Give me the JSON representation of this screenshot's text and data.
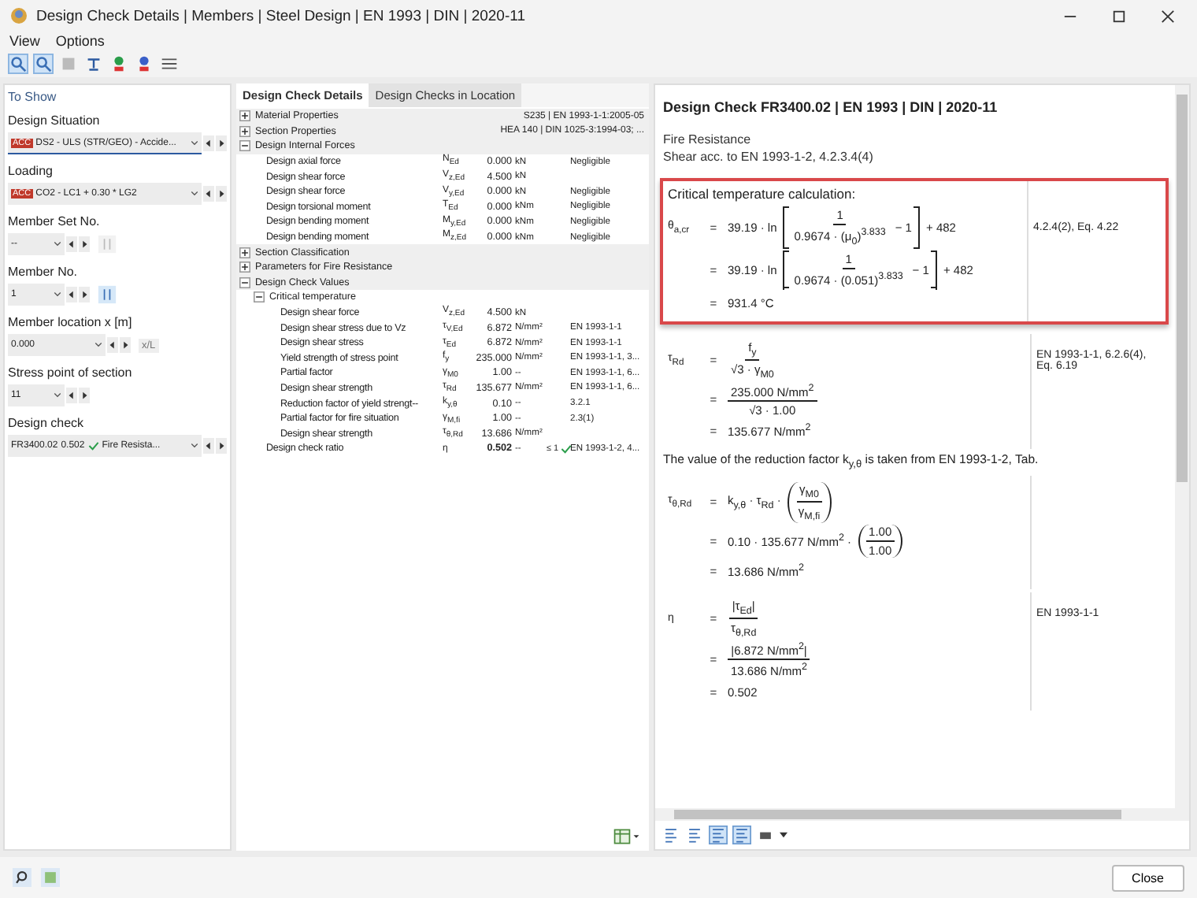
{
  "window": {
    "title": "Design Check Details | Members | Steel Design | EN 1993 | DIN | 2020-11"
  },
  "menu": [
    "View",
    "Options"
  ],
  "toolbar": [
    {
      "selected": true
    },
    {
      "selected": true
    },
    {
      "selected": false
    },
    {
      "selected": false
    },
    {
      "selected": false
    },
    {
      "selected": false
    },
    {
      "selected": false
    }
  ],
  "left_panel": {
    "title": "To Show",
    "fields": [
      {
        "kind": "combo",
        "label": "Design Situation",
        "badge": "ACC",
        "value": "DS2 - ULS (STR/GEO) - Accide...",
        "focused": true
      },
      {
        "kind": "combo",
        "label": "Loading",
        "badge": "ACC",
        "value": "CO2 - LC1 + 0.30 * LG2",
        "focused": false
      },
      {
        "kind": "pick",
        "label": "Member Set No.",
        "value": "--",
        "disabled": true
      },
      {
        "kind": "pick",
        "label": "Member No.",
        "value": "1",
        "disabled": false
      },
      {
        "kind": "unit",
        "label": "Member location x [m]",
        "value": "0.000",
        "unit": "x/L"
      },
      {
        "kind": "small",
        "label": "Stress point of section",
        "value": "11"
      },
      {
        "kind": "check",
        "label": "Design check",
        "code": "FR3400.02",
        "ratio": "0.502",
        "ok": true,
        "value": "Fire Resista..."
      }
    ]
  },
  "tabs": [
    {
      "label": "Design Check Details",
      "selected": true
    },
    {
      "label": "Design Checks in Location",
      "selected": false
    }
  ],
  "tree": [
    {
      "kind": "group",
      "label": "Material Properties",
      "expanded": false,
      "summary": "S235 | EN 1993-1-1:2005-05"
    },
    {
      "kind": "group",
      "label": "Section Properties",
      "expanded": false,
      "summary": "HEA 140 | DIN 1025-3:1994-03; ..."
    },
    {
      "kind": "group",
      "label": "Design Internal Forces",
      "expanded": true,
      "children": [
        {
          "kind": "row",
          "label": "Design axial force",
          "symbol": "N$_{Ed}$",
          "value": "0.000",
          "unit": "kN",
          "note": "Negligible"
        },
        {
          "kind": "row",
          "label": "Design shear force",
          "symbol": "V$_{z,Ed}$",
          "value": "4.500",
          "unit": "kN"
        },
        {
          "kind": "row",
          "label": "Design shear force",
          "symbol": "V$_{y,Ed}$",
          "value": "0.000",
          "unit": "kN",
          "note": "Negligible"
        },
        {
          "kind": "row",
          "label": "Design torsional moment",
          "symbol": "T$_{Ed}$",
          "value": "0.000",
          "unit": "kNm",
          "note": "Negligible"
        },
        {
          "kind": "row",
          "label": "Design bending moment",
          "symbol": "M$_{y,Ed}$",
          "value": "0.000",
          "unit": "kNm",
          "note": "Negligible"
        },
        {
          "kind": "row",
          "label": "Design bending moment",
          "symbol": "M$_{z,Ed}$",
          "value": "0.000",
          "unit": "kNm",
          "note": "Negligible"
        }
      ]
    },
    {
      "kind": "group",
      "label": "Section Classification",
      "expanded": false
    },
    {
      "kind": "group",
      "label": "Parameters for Fire Resistance",
      "expanded": false
    },
    {
      "kind": "group",
      "label": "Design Check Values",
      "expanded": true,
      "children": [
        {
          "kind": "group",
          "label": "Critical temperature",
          "expanded": true,
          "children": [
            {
              "kind": "row",
              "label": "Design shear force",
              "symbol": "V$_{z,Ed}$",
              "value": "4.500",
              "unit": "kN"
            },
            {
              "kind": "row",
              "label": "Design shear stress due to Vz",
              "symbol": "τ$_{V,Ed}$",
              "value": "6.872",
              "unit": "N/mm²",
              "note": "EN 1993-1-1"
            },
            {
              "kind": "row",
              "label": "Design shear stress",
              "symbol": "τ$_{Ed}$",
              "value": "6.872",
              "unit": "N/mm²",
              "note": "EN 1993-1-1"
            },
            {
              "kind": "row",
              "label": "Yield strength of stress point",
              "symbol": "f$_{y}$",
              "value": "235.000",
              "unit": "N/mm²",
              "note": "EN 1993-1-1, 3..."
            },
            {
              "kind": "row",
              "label": "Partial factor",
              "symbol": "γ$_{M0}$",
              "value": "1.00",
              "unit": "--",
              "note": "EN 1993-1-1, 6..."
            },
            {
              "kind": "row",
              "label": "Design shear strength",
              "symbol": "τ$_{Rd}$",
              "value": "135.677",
              "unit": "N/mm²",
              "note": "EN 1993-1-1, 6..."
            },
            {
              "kind": "row",
              "label": "Reduction factor of yield strengt--",
              "symbol": "k$_{y,θ}$",
              "value": "0.10",
              "unit": "--",
              "note": "3.2.1"
            },
            {
              "kind": "row",
              "label": "Partial factor for fire situation",
              "symbol": "γ$_{M,fi}$",
              "value": "1.00",
              "unit": "--",
              "note": "2.3(1)"
            },
            {
              "kind": "row",
              "label": "Design shear strength",
              "symbol": "τ$_{θ,Rd}$",
              "value": "13.686",
              "unit": "N/mm²"
            }
          ]
        },
        {
          "kind": "result",
          "label": "Design check ratio",
          "symbol": "η",
          "value": "0.502",
          "unit": "--",
          "limit": "≤ 1",
          "ok": true,
          "note": "EN 1993-1-2, 4..."
        }
      ]
    }
  ],
  "report": {
    "title": "Design Check FR3400.02 | EN 1993 | DIN | 2020-11",
    "subtitle": [
      "Fire Resistance",
      "Shear acc. to EN 1993-1-2, 4.2.3.4(4)"
    ],
    "blocks": [
      {
        "kind": "equation",
        "highlighted": true,
        "caption": "Critical temperature calculation:",
        "reference": "4.2.4(2), Eq. 4.22",
        "lines": [
          {
            "kind": "bracket-frac",
            "lhs": "θ$_{a,cr}$",
            "sign": "=",
            "pre": "39.19 · ln",
            "num": "1",
            "den": "0.9674 · (μ$_{0}$)$^{3.833}$",
            "inner": "− 1",
            "post": "+ 482"
          },
          {
            "kind": "bracket-frac",
            "sign": "=",
            "pre": "39.19 · ln",
            "num": "1",
            "den": "0.9674 · (0.051)$^{3.833}$",
            "inner": "− 1",
            "post": "+ 482"
          },
          {
            "kind": "plain",
            "sign": "=",
            "pre": "931.4 °C"
          }
        ]
      },
      {
        "kind": "equation",
        "highlighted": false,
        "reference": "EN 1993-1-1, 6.2.6(4), Eq. 6.19",
        "lines": [
          {
            "kind": "frac",
            "lhs": "τ$_{Rd}$",
            "sign": "=",
            "num": "f$_{y}$",
            "den": "√3 · γ$_{M0}$"
          },
          {
            "kind": "frac",
            "sign": "=",
            "num": "235.000 N/mm$^{2}$",
            "den": "√3 · 1.00"
          },
          {
            "kind": "plain",
            "sign": "=",
            "pre": "135.677 N/mm$^{2}$"
          }
        ]
      },
      {
        "kind": "text",
        "text": "The value of the reduction factor k$_{y,θ}$ is taken from EN 1993-1-2, Tab."
      },
      {
        "kind": "equation",
        "highlighted": false,
        "lines": [
          {
            "kind": "paren-frac",
            "lhs": "τ$_{θ,Rd}$",
            "sign": "=",
            "pre": "k$_{y,θ}$ · τ$_{Rd}$ ·",
            "num": "γ$_{M0}$",
            "den": "γ$_{M,fi}$"
          },
          {
            "kind": "paren-frac",
            "sign": "=",
            "pre": "0.10 · 135.677 N/mm$^{2}$ ·",
            "num": "1.00",
            "den": "1.00"
          },
          {
            "kind": "plain",
            "sign": "=",
            "pre": "13.686 N/mm$^{2}$"
          }
        ]
      },
      {
        "kind": "equation",
        "highlighted": false,
        "reference": "EN 1993-1-1",
        "lines": [
          {
            "kind": "frac",
            "lhs": "η",
            "sign": "=",
            "num": "|τ$_{Ed}$|",
            "den": "τ$_{θ,Rd}$"
          },
          {
            "kind": "frac",
            "sign": "=",
            "num": "|6.872 N/mm$^{2}$|",
            "den": "13.686 N/mm$^{2}$"
          },
          {
            "kind": "plain",
            "sign": "=",
            "pre": "0.502"
          }
        ]
      }
    ]
  },
  "report_toolbar": [
    {
      "selected": false
    },
    {
      "selected": false
    },
    {
      "selected": true
    },
    {
      "selected": true
    },
    {
      "selected": false
    }
  ],
  "close_button": "Close"
}
